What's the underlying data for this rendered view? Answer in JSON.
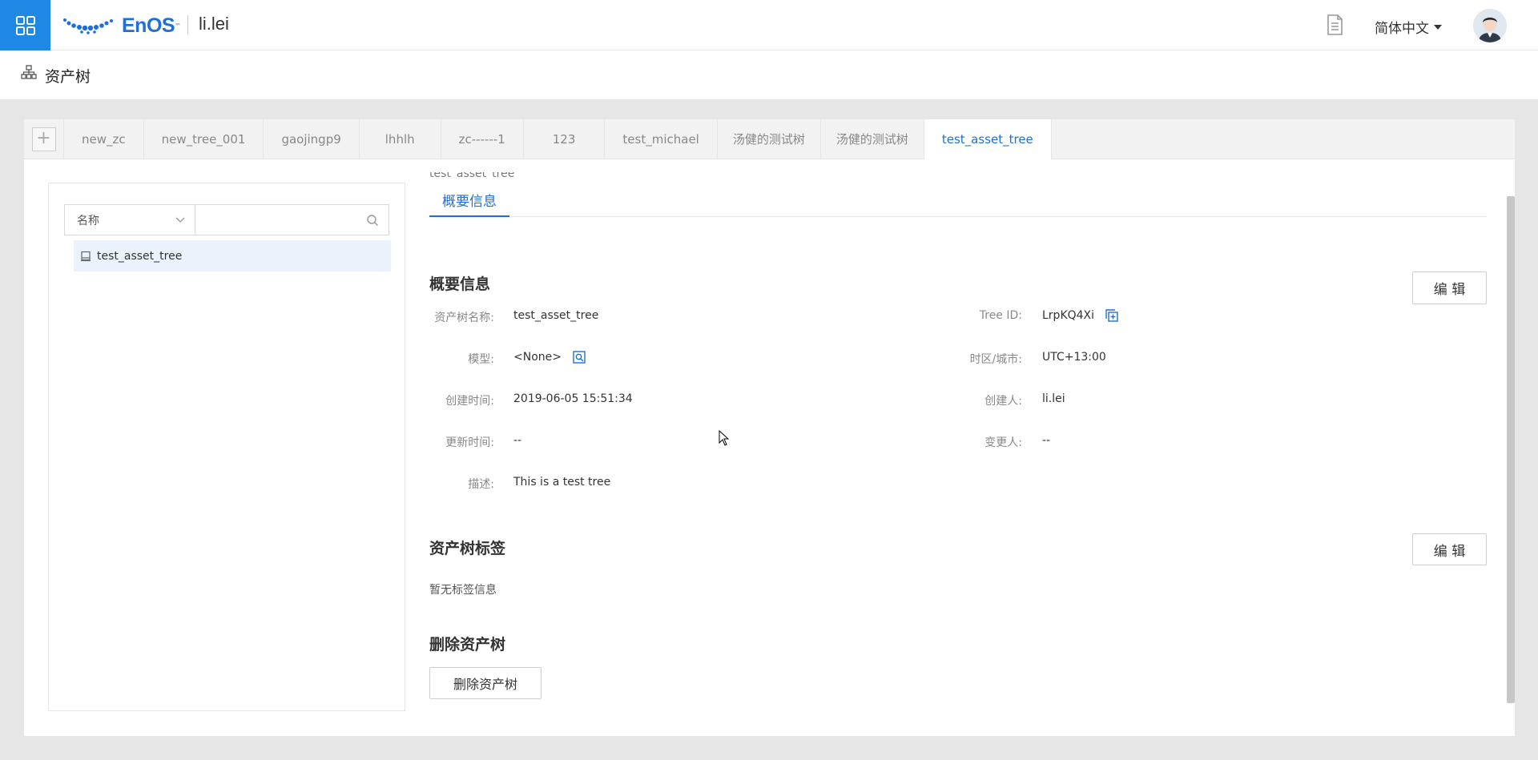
{
  "topbar": {
    "logo_text": "EnOS",
    "logo_tm": "™",
    "username": "li.lei",
    "language": "简体中文",
    "icons": {
      "apps": "grid-icon",
      "docs": "document-icon",
      "avatar": "user-avatar"
    },
    "brand_color": "#1e88e5"
  },
  "page": {
    "title": "资产树",
    "icon": "tree-structure-icon"
  },
  "tabs": {
    "add_label": "+",
    "items": [
      {
        "label": "new_zc"
      },
      {
        "label": "new_tree_001"
      },
      {
        "label": "gaojingp9"
      },
      {
        "label": "lhhlh"
      },
      {
        "label": "zc------1"
      },
      {
        "label": "123"
      },
      {
        "label": "test_michael"
      },
      {
        "label": "汤健的测试树"
      },
      {
        "label": "汤健的测试树"
      },
      {
        "label": "test_asset_tree"
      }
    ],
    "active_index": 9
  },
  "left": {
    "search_select": "名称",
    "search_value": "",
    "tree_nodes": [
      {
        "label": "test_asset_tree"
      }
    ]
  },
  "detail": {
    "clipped_title": "test_asset_tree",
    "subtab": "概要信息",
    "overview": {
      "title": "概要信息",
      "edit_label": "编 辑",
      "fields": {
        "name_label": "资产树名称:",
        "name_value": "test_asset_tree",
        "treeid_label": "Tree ID:",
        "treeid_value": "LrpKQ4Xi",
        "model_label": "模型:",
        "model_value": "<None>",
        "timezone_label": "时区/城市:",
        "timezone_value": "UTC+13:00",
        "created_label": "创建时间:",
        "created_value": "2019-06-05 15:51:34",
        "creator_label": "创建人:",
        "creator_value": "li.lei",
        "updated_label": "更新时间:",
        "updated_value": "--",
        "modifier_label": "变更人:",
        "modifier_value": "--",
        "desc_label": "描述:",
        "desc_value": "This is a test tree"
      }
    },
    "tags": {
      "title": "资产树标签",
      "edit_label": "编 辑",
      "empty_text": "暂无标签信息"
    },
    "delete": {
      "title": "删除资产树",
      "button_label": "删除资产树"
    }
  }
}
